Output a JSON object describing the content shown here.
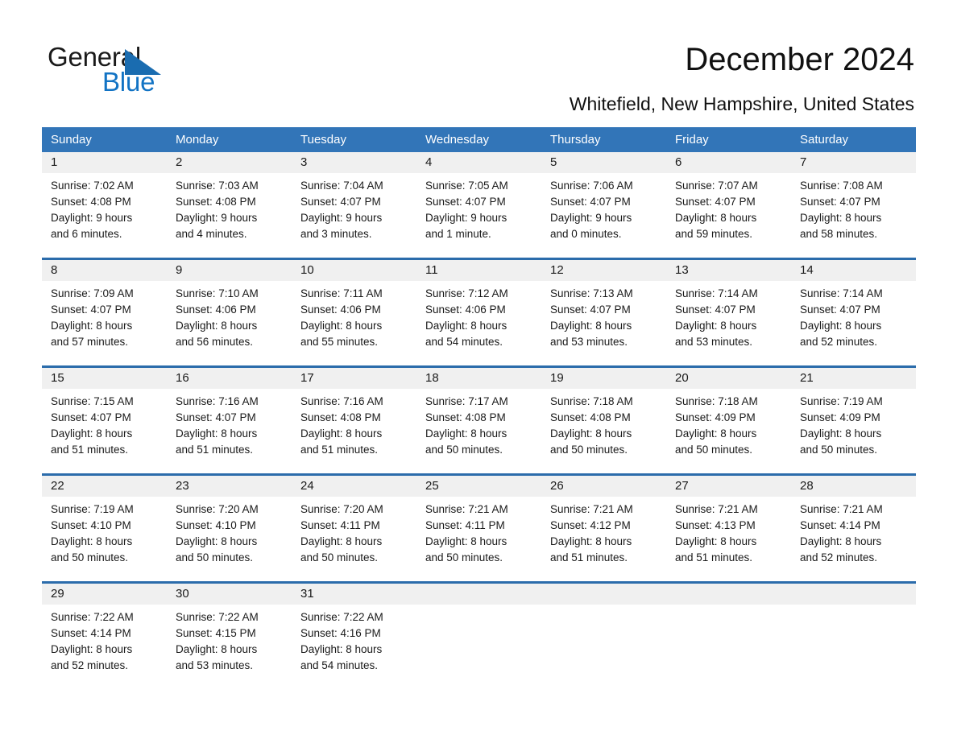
{
  "brand": {
    "name_part1": "General",
    "name_part2": "Blue",
    "accent_color": "#1273c4",
    "triangle_color": "#1a6cb0"
  },
  "header": {
    "title": "December 2024",
    "location": "Whitefield, New Hampshire, United States"
  },
  "calendar": {
    "header_bg": "#3275b8",
    "rule_color": "#2b6cab",
    "daynum_bg": "#f0f0f0",
    "weekdays": [
      "Sunday",
      "Monday",
      "Tuesday",
      "Wednesday",
      "Thursday",
      "Friday",
      "Saturday"
    ],
    "weeks": [
      [
        {
          "day": "1",
          "sunrise": "Sunrise: 7:02 AM",
          "sunset": "Sunset: 4:08 PM",
          "daylight1": "Daylight: 9 hours",
          "daylight2": "and 6 minutes."
        },
        {
          "day": "2",
          "sunrise": "Sunrise: 7:03 AM",
          "sunset": "Sunset: 4:08 PM",
          "daylight1": "Daylight: 9 hours",
          "daylight2": "and 4 minutes."
        },
        {
          "day": "3",
          "sunrise": "Sunrise: 7:04 AM",
          "sunset": "Sunset: 4:07 PM",
          "daylight1": "Daylight: 9 hours",
          "daylight2": "and 3 minutes."
        },
        {
          "day": "4",
          "sunrise": "Sunrise: 7:05 AM",
          "sunset": "Sunset: 4:07 PM",
          "daylight1": "Daylight: 9 hours",
          "daylight2": "and 1 minute."
        },
        {
          "day": "5",
          "sunrise": "Sunrise: 7:06 AM",
          "sunset": "Sunset: 4:07 PM",
          "daylight1": "Daylight: 9 hours",
          "daylight2": "and 0 minutes."
        },
        {
          "day": "6",
          "sunrise": "Sunrise: 7:07 AM",
          "sunset": "Sunset: 4:07 PM",
          "daylight1": "Daylight: 8 hours",
          "daylight2": "and 59 minutes."
        },
        {
          "day": "7",
          "sunrise": "Sunrise: 7:08 AM",
          "sunset": "Sunset: 4:07 PM",
          "daylight1": "Daylight: 8 hours",
          "daylight2": "and 58 minutes."
        }
      ],
      [
        {
          "day": "8",
          "sunrise": "Sunrise: 7:09 AM",
          "sunset": "Sunset: 4:07 PM",
          "daylight1": "Daylight: 8 hours",
          "daylight2": "and 57 minutes."
        },
        {
          "day": "9",
          "sunrise": "Sunrise: 7:10 AM",
          "sunset": "Sunset: 4:06 PM",
          "daylight1": "Daylight: 8 hours",
          "daylight2": "and 56 minutes."
        },
        {
          "day": "10",
          "sunrise": "Sunrise: 7:11 AM",
          "sunset": "Sunset: 4:06 PM",
          "daylight1": "Daylight: 8 hours",
          "daylight2": "and 55 minutes."
        },
        {
          "day": "11",
          "sunrise": "Sunrise: 7:12 AM",
          "sunset": "Sunset: 4:06 PM",
          "daylight1": "Daylight: 8 hours",
          "daylight2": "and 54 minutes."
        },
        {
          "day": "12",
          "sunrise": "Sunrise: 7:13 AM",
          "sunset": "Sunset: 4:07 PM",
          "daylight1": "Daylight: 8 hours",
          "daylight2": "and 53 minutes."
        },
        {
          "day": "13",
          "sunrise": "Sunrise: 7:14 AM",
          "sunset": "Sunset: 4:07 PM",
          "daylight1": "Daylight: 8 hours",
          "daylight2": "and 53 minutes."
        },
        {
          "day": "14",
          "sunrise": "Sunrise: 7:14 AM",
          "sunset": "Sunset: 4:07 PM",
          "daylight1": "Daylight: 8 hours",
          "daylight2": "and 52 minutes."
        }
      ],
      [
        {
          "day": "15",
          "sunrise": "Sunrise: 7:15 AM",
          "sunset": "Sunset: 4:07 PM",
          "daylight1": "Daylight: 8 hours",
          "daylight2": "and 51 minutes."
        },
        {
          "day": "16",
          "sunrise": "Sunrise: 7:16 AM",
          "sunset": "Sunset: 4:07 PM",
          "daylight1": "Daylight: 8 hours",
          "daylight2": "and 51 minutes."
        },
        {
          "day": "17",
          "sunrise": "Sunrise: 7:16 AM",
          "sunset": "Sunset: 4:08 PM",
          "daylight1": "Daylight: 8 hours",
          "daylight2": "and 51 minutes."
        },
        {
          "day": "18",
          "sunrise": "Sunrise: 7:17 AM",
          "sunset": "Sunset: 4:08 PM",
          "daylight1": "Daylight: 8 hours",
          "daylight2": "and 50 minutes."
        },
        {
          "day": "19",
          "sunrise": "Sunrise: 7:18 AM",
          "sunset": "Sunset: 4:08 PM",
          "daylight1": "Daylight: 8 hours",
          "daylight2": "and 50 minutes."
        },
        {
          "day": "20",
          "sunrise": "Sunrise: 7:18 AM",
          "sunset": "Sunset: 4:09 PM",
          "daylight1": "Daylight: 8 hours",
          "daylight2": "and 50 minutes."
        },
        {
          "day": "21",
          "sunrise": "Sunrise: 7:19 AM",
          "sunset": "Sunset: 4:09 PM",
          "daylight1": "Daylight: 8 hours",
          "daylight2": "and 50 minutes."
        }
      ],
      [
        {
          "day": "22",
          "sunrise": "Sunrise: 7:19 AM",
          "sunset": "Sunset: 4:10 PM",
          "daylight1": "Daylight: 8 hours",
          "daylight2": "and 50 minutes."
        },
        {
          "day": "23",
          "sunrise": "Sunrise: 7:20 AM",
          "sunset": "Sunset: 4:10 PM",
          "daylight1": "Daylight: 8 hours",
          "daylight2": "and 50 minutes."
        },
        {
          "day": "24",
          "sunrise": "Sunrise: 7:20 AM",
          "sunset": "Sunset: 4:11 PM",
          "daylight1": "Daylight: 8 hours",
          "daylight2": "and 50 minutes."
        },
        {
          "day": "25",
          "sunrise": "Sunrise: 7:21 AM",
          "sunset": "Sunset: 4:11 PM",
          "daylight1": "Daylight: 8 hours",
          "daylight2": "and 50 minutes."
        },
        {
          "day": "26",
          "sunrise": "Sunrise: 7:21 AM",
          "sunset": "Sunset: 4:12 PM",
          "daylight1": "Daylight: 8 hours",
          "daylight2": "and 51 minutes."
        },
        {
          "day": "27",
          "sunrise": "Sunrise: 7:21 AM",
          "sunset": "Sunset: 4:13 PM",
          "daylight1": "Daylight: 8 hours",
          "daylight2": "and 51 minutes."
        },
        {
          "day": "28",
          "sunrise": "Sunrise: 7:21 AM",
          "sunset": "Sunset: 4:14 PM",
          "daylight1": "Daylight: 8 hours",
          "daylight2": "and 52 minutes."
        }
      ],
      [
        {
          "day": "29",
          "sunrise": "Sunrise: 7:22 AM",
          "sunset": "Sunset: 4:14 PM",
          "daylight1": "Daylight: 8 hours",
          "daylight2": "and 52 minutes."
        },
        {
          "day": "30",
          "sunrise": "Sunrise: 7:22 AM",
          "sunset": "Sunset: 4:15 PM",
          "daylight1": "Daylight: 8 hours",
          "daylight2": "and 53 minutes."
        },
        {
          "day": "31",
          "sunrise": "Sunrise: 7:22 AM",
          "sunset": "Sunset: 4:16 PM",
          "daylight1": "Daylight: 8 hours",
          "daylight2": "and 54 minutes."
        },
        {
          "day": "",
          "sunrise": "",
          "sunset": "",
          "daylight1": "",
          "daylight2": ""
        },
        {
          "day": "",
          "sunrise": "",
          "sunset": "",
          "daylight1": "",
          "daylight2": ""
        },
        {
          "day": "",
          "sunrise": "",
          "sunset": "",
          "daylight1": "",
          "daylight2": ""
        },
        {
          "day": "",
          "sunrise": "",
          "sunset": "",
          "daylight1": "",
          "daylight2": ""
        }
      ]
    ]
  }
}
